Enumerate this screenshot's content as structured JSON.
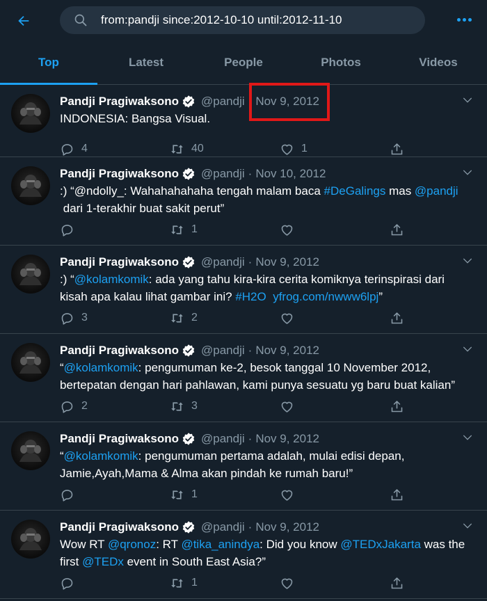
{
  "search": {
    "query": "from:pandji since:2012-10-10 until:2012-11-10"
  },
  "tabs": [
    {
      "label": "Top",
      "active": true
    },
    {
      "label": "Latest",
      "active": false
    },
    {
      "label": "People",
      "active": false
    },
    {
      "label": "Photos",
      "active": false
    },
    {
      "label": "Videos",
      "active": false
    }
  ],
  "colors": {
    "background": "#15202b",
    "accent": "#1da1f2",
    "muted": "#8899a6",
    "highlight": "#e01818"
  },
  "tweets": [
    {
      "name": "Pandji Pragiwaksono",
      "handle": "@pandji",
      "sep": "·",
      "date": "Nov 9, 2012",
      "segments": [
        {
          "t": "INDONESIA: Bangsa Visual.",
          "link": false
        }
      ],
      "replies": "4",
      "retweets": "40",
      "likes": "1"
    },
    {
      "name": "Pandji Pragiwaksono",
      "handle": "@pandji",
      "sep": "·",
      "date": "Nov 10, 2012",
      "segments": [
        {
          "t": ":) “@ndolly_: Wahahahahaha tengah malam baca ",
          "link": false
        },
        {
          "t": "#DeGalings",
          "link": true
        },
        {
          "t": " mas ",
          "link": false
        },
        {
          "t": "@pandji",
          "link": true
        },
        {
          "t": "\n dari 1-terakhir buat sakit perut”",
          "link": false
        }
      ],
      "replies": "",
      "retweets": "1",
      "likes": ""
    },
    {
      "name": "Pandji Pragiwaksono",
      "handle": "@pandji",
      "sep": "·",
      "date": "Nov 9, 2012",
      "segments": [
        {
          "t": ":) “",
          "link": false
        },
        {
          "t": "@kolamkomik",
          "link": true
        },
        {
          "t": ": ada yang tahu kira-kira cerita komiknya terinspirasi dari\nkisah apa kalau lihat gambar ini? ",
          "link": false
        },
        {
          "t": "#H2O",
          "link": true
        },
        {
          "t": "  ",
          "link": false
        },
        {
          "t": "yfrog.com/nwww6lpj",
          "link": true
        },
        {
          "t": "”",
          "link": false
        }
      ],
      "replies": "3",
      "retweets": "2",
      "likes": ""
    },
    {
      "name": "Pandji Pragiwaksono",
      "handle": "@pandji",
      "sep": "·",
      "date": "Nov 9, 2012",
      "segments": [
        {
          "t": "“",
          "link": false
        },
        {
          "t": "@kolamkomik",
          "link": true
        },
        {
          "t": ": pengumuman ke-2, besok tanggal 10 November 2012,\nbertepatan dengan hari pahlawan, kami punya sesuatu yg baru buat kalian”",
          "link": false
        }
      ],
      "replies": "2",
      "retweets": "3",
      "likes": ""
    },
    {
      "name": "Pandji Pragiwaksono",
      "handle": "@pandji",
      "sep": "·",
      "date": "Nov 9, 2012",
      "segments": [
        {
          "t": "“",
          "link": false
        },
        {
          "t": "@kolamkomik",
          "link": true
        },
        {
          "t": ": pengumuman pertama adalah, mulai edisi depan,\nJamie,Ayah,Mama & Alma akan pindah ke rumah baru!”",
          "link": false
        }
      ],
      "replies": "",
      "retweets": "1",
      "likes": ""
    },
    {
      "name": "Pandji Pragiwaksono",
      "handle": "@pandji",
      "sep": "·",
      "date": "Nov 9, 2012",
      "segments": [
        {
          "t": "Wow RT ",
          "link": false
        },
        {
          "t": "@qronoz",
          "link": true
        },
        {
          "t": ": RT ",
          "link": false
        },
        {
          "t": "@tika_anindya",
          "link": true
        },
        {
          "t": ": Did you know ",
          "link": false
        },
        {
          "t": "@TEDxJakarta",
          "link": true
        },
        {
          "t": " was the\nfirst ",
          "link": false
        },
        {
          "t": "@TEDx",
          "link": true
        },
        {
          "t": " event in South East Asia?”",
          "link": false
        }
      ],
      "replies": "",
      "retweets": "1",
      "likes": ""
    }
  ]
}
